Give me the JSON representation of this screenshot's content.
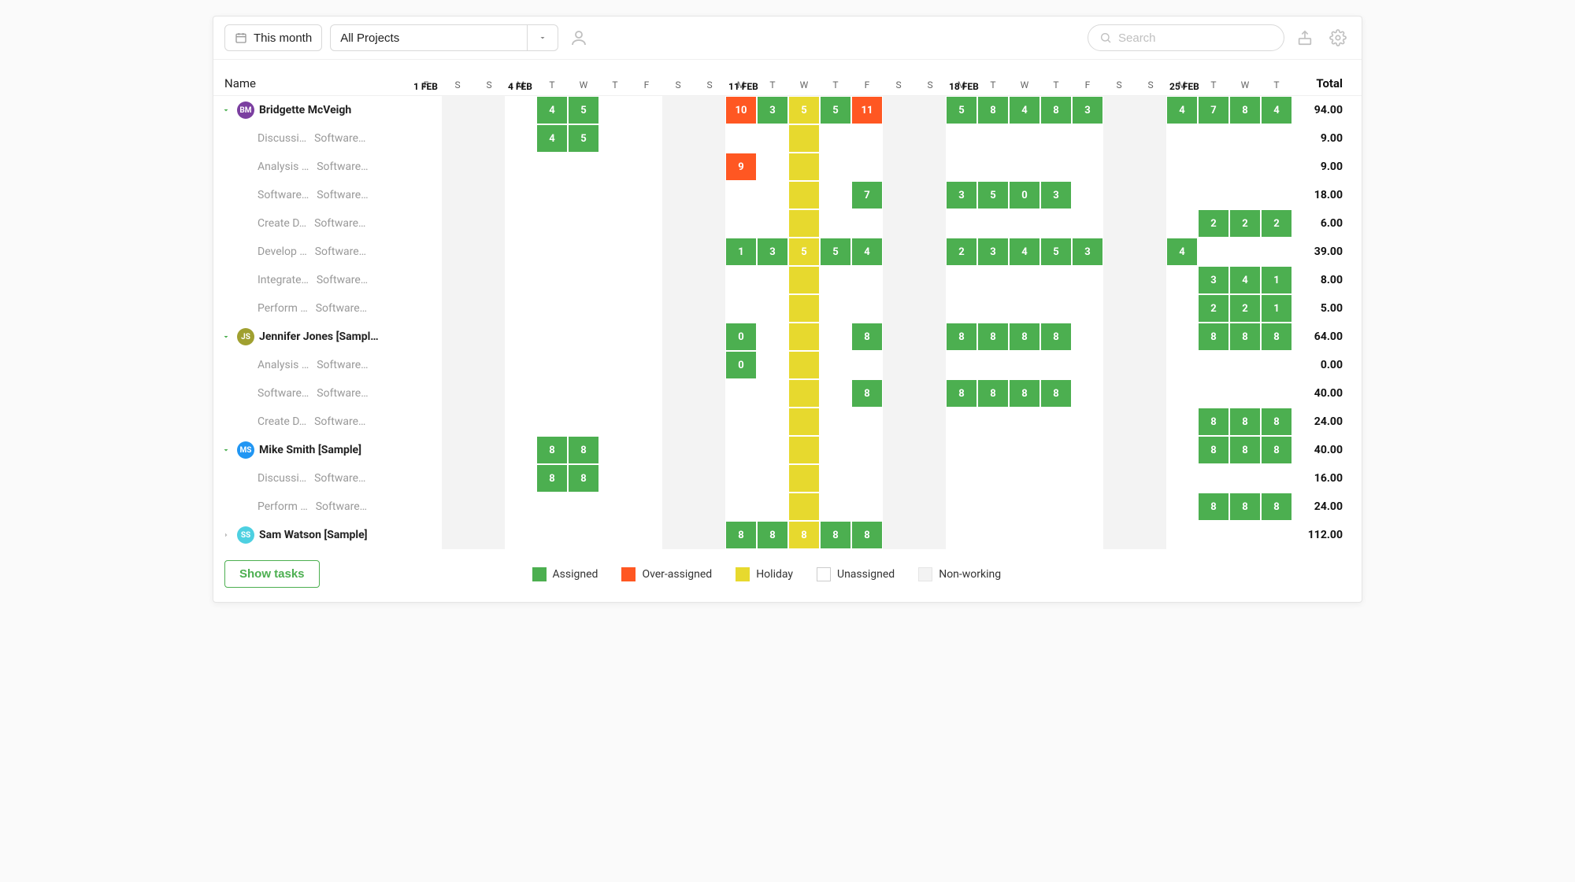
{
  "toolbar": {
    "range_label": "This month",
    "project_filter": "All Projects",
    "search_placeholder": "Search"
  },
  "header": {
    "name_label": "Name",
    "total_label": "Total",
    "days": [
      {
        "dow": "F",
        "weekstart": "1 FEB",
        "nonwork": false
      },
      {
        "dow": "S",
        "nonwork": true
      },
      {
        "dow": "S",
        "nonwork": true
      },
      {
        "dow": "M",
        "weekstart": "4 FEB",
        "nonwork": false
      },
      {
        "dow": "T",
        "nonwork": false
      },
      {
        "dow": "W",
        "nonwork": false
      },
      {
        "dow": "T",
        "nonwork": false
      },
      {
        "dow": "F",
        "nonwork": false
      },
      {
        "dow": "S",
        "nonwork": true
      },
      {
        "dow": "S",
        "nonwork": true
      },
      {
        "dow": "M",
        "weekstart": "11 FEB",
        "nonwork": false
      },
      {
        "dow": "T",
        "nonwork": false
      },
      {
        "dow": "W",
        "nonwork": false,
        "holiday": true
      },
      {
        "dow": "T",
        "nonwork": false
      },
      {
        "dow": "F",
        "nonwork": false
      },
      {
        "dow": "S",
        "nonwork": true
      },
      {
        "dow": "S",
        "nonwork": true
      },
      {
        "dow": "M",
        "weekstart": "18 FEB",
        "nonwork": false
      },
      {
        "dow": "T",
        "nonwork": false
      },
      {
        "dow": "W",
        "nonwork": false
      },
      {
        "dow": "T",
        "nonwork": false
      },
      {
        "dow": "F",
        "nonwork": false
      },
      {
        "dow": "S",
        "nonwork": true
      },
      {
        "dow": "S",
        "nonwork": true
      },
      {
        "dow": "M",
        "weekstart": "25 FEB",
        "nonwork": false
      },
      {
        "dow": "T",
        "nonwork": false
      },
      {
        "dow": "W",
        "nonwork": false
      },
      {
        "dow": "T",
        "nonwork": false
      }
    ]
  },
  "rows": [
    {
      "type": "person",
      "expanded": true,
      "avatar": {
        "initials": "BM",
        "bg": "#7b3fa0"
      },
      "name": "Bridgette McVeigh",
      "total": "94.00",
      "cells": [
        null,
        null,
        null,
        null,
        {
          "v": "4",
          "t": "assigned"
        },
        {
          "v": "5",
          "t": "assigned"
        },
        null,
        null,
        null,
        null,
        {
          "v": "10",
          "t": "over"
        },
        {
          "v": "3",
          "t": "assigned"
        },
        {
          "v": "5",
          "t": "holiday"
        },
        {
          "v": "5",
          "t": "assigned"
        },
        {
          "v": "11",
          "t": "over"
        },
        null,
        null,
        {
          "v": "5",
          "t": "assigned"
        },
        {
          "v": "8",
          "t": "assigned"
        },
        {
          "v": "4",
          "t": "assigned"
        },
        {
          "v": "8",
          "t": "assigned"
        },
        {
          "v": "3",
          "t": "assigned"
        },
        null,
        null,
        {
          "v": "4",
          "t": "assigned"
        },
        {
          "v": "7",
          "t": "assigned"
        },
        {
          "v": "8",
          "t": "assigned"
        },
        {
          "v": "4",
          "t": "assigned"
        }
      ]
    },
    {
      "type": "task",
      "task": "Discussi…",
      "project": "Software…",
      "total": "9.00",
      "cells": [
        null,
        null,
        null,
        null,
        {
          "v": "4",
          "t": "assigned"
        },
        {
          "v": "5",
          "t": "assigned"
        },
        null,
        null,
        null,
        null,
        null,
        null,
        {
          "t": "holiday-bg"
        },
        null,
        null,
        null,
        null,
        null,
        null,
        null,
        null,
        null,
        null,
        null,
        null,
        null,
        null,
        null
      ]
    },
    {
      "type": "task",
      "task": "Analysis …",
      "project": "Software…",
      "total": "9.00",
      "cells": [
        null,
        null,
        null,
        null,
        null,
        null,
        null,
        null,
        null,
        null,
        {
          "v": "9",
          "t": "over"
        },
        null,
        {
          "t": "holiday-bg"
        },
        null,
        null,
        null,
        null,
        null,
        null,
        null,
        null,
        null,
        null,
        null,
        null,
        null,
        null,
        null
      ]
    },
    {
      "type": "task",
      "task": "Software…",
      "project": "Software…",
      "total": "18.00",
      "cells": [
        null,
        null,
        null,
        null,
        null,
        null,
        null,
        null,
        null,
        null,
        null,
        null,
        {
          "t": "holiday-bg"
        },
        null,
        {
          "v": "7",
          "t": "assigned"
        },
        null,
        null,
        {
          "v": "3",
          "t": "assigned"
        },
        {
          "v": "5",
          "t": "assigned"
        },
        {
          "v": "0",
          "t": "assigned"
        },
        {
          "v": "3",
          "t": "assigned"
        },
        null,
        null,
        null,
        null,
        null,
        null,
        null
      ]
    },
    {
      "type": "task",
      "task": "Create D…",
      "project": "Software…",
      "total": "6.00",
      "cells": [
        null,
        null,
        null,
        null,
        null,
        null,
        null,
        null,
        null,
        null,
        null,
        null,
        {
          "t": "holiday-bg"
        },
        null,
        null,
        null,
        null,
        null,
        null,
        null,
        null,
        null,
        null,
        null,
        null,
        {
          "v": "2",
          "t": "assigned"
        },
        {
          "v": "2",
          "t": "assigned"
        },
        {
          "v": "2",
          "t": "assigned"
        }
      ]
    },
    {
      "type": "task",
      "task": "Develop …",
      "project": "Software…",
      "total": "39.00",
      "cells": [
        null,
        null,
        null,
        null,
        null,
        null,
        null,
        null,
        null,
        null,
        {
          "v": "1",
          "t": "assigned"
        },
        {
          "v": "3",
          "t": "assigned"
        },
        {
          "v": "5",
          "t": "holiday"
        },
        {
          "v": "5",
          "t": "assigned"
        },
        {
          "v": "4",
          "t": "assigned"
        },
        null,
        null,
        {
          "v": "2",
          "t": "assigned"
        },
        {
          "v": "3",
          "t": "assigned"
        },
        {
          "v": "4",
          "t": "assigned"
        },
        {
          "v": "5",
          "t": "assigned"
        },
        {
          "v": "3",
          "t": "assigned"
        },
        null,
        null,
        {
          "v": "4",
          "t": "assigned"
        },
        null,
        null,
        null
      ]
    },
    {
      "type": "task",
      "task": "Integrate…",
      "project": "Software…",
      "total": "8.00",
      "cells": [
        null,
        null,
        null,
        null,
        null,
        null,
        null,
        null,
        null,
        null,
        null,
        null,
        {
          "t": "holiday-bg"
        },
        null,
        null,
        null,
        null,
        null,
        null,
        null,
        null,
        null,
        null,
        null,
        null,
        {
          "v": "3",
          "t": "assigned"
        },
        {
          "v": "4",
          "t": "assigned"
        },
        {
          "v": "1",
          "t": "assigned"
        }
      ]
    },
    {
      "type": "task",
      "task": "Perform …",
      "project": "Software…",
      "total": "5.00",
      "cells": [
        null,
        null,
        null,
        null,
        null,
        null,
        null,
        null,
        null,
        null,
        null,
        null,
        {
          "t": "holiday-bg"
        },
        null,
        null,
        null,
        null,
        null,
        null,
        null,
        null,
        null,
        null,
        null,
        null,
        {
          "v": "2",
          "t": "assigned"
        },
        {
          "v": "2",
          "t": "assigned"
        },
        {
          "v": "1",
          "t": "assigned"
        }
      ]
    },
    {
      "type": "person",
      "expanded": true,
      "avatar": {
        "initials": "JS",
        "bg": "#a0a030"
      },
      "name": "Jennifer Jones [Sampl…",
      "total": "64.00",
      "cells": [
        null,
        null,
        null,
        null,
        null,
        null,
        null,
        null,
        null,
        null,
        {
          "v": "0",
          "t": "assigned"
        },
        null,
        {
          "t": "holiday-bg"
        },
        null,
        {
          "v": "8",
          "t": "assigned"
        },
        null,
        null,
        {
          "v": "8",
          "t": "assigned"
        },
        {
          "v": "8",
          "t": "assigned"
        },
        {
          "v": "8",
          "t": "assigned"
        },
        {
          "v": "8",
          "t": "assigned"
        },
        null,
        null,
        null,
        null,
        {
          "v": "8",
          "t": "assigned"
        },
        {
          "v": "8",
          "t": "assigned"
        },
        {
          "v": "8",
          "t": "assigned"
        }
      ]
    },
    {
      "type": "task",
      "task": "Analysis …",
      "project": "Software…",
      "total": "0.00",
      "cells": [
        null,
        null,
        null,
        null,
        null,
        null,
        null,
        null,
        null,
        null,
        {
          "v": "0",
          "t": "assigned"
        },
        null,
        {
          "t": "holiday-bg"
        },
        null,
        null,
        null,
        null,
        null,
        null,
        null,
        null,
        null,
        null,
        null,
        null,
        null,
        null,
        null
      ]
    },
    {
      "type": "task",
      "task": "Software…",
      "project": "Software…",
      "total": "40.00",
      "cells": [
        null,
        null,
        null,
        null,
        null,
        null,
        null,
        null,
        null,
        null,
        null,
        null,
        {
          "t": "holiday-bg"
        },
        null,
        {
          "v": "8",
          "t": "assigned"
        },
        null,
        null,
        {
          "v": "8",
          "t": "assigned"
        },
        {
          "v": "8",
          "t": "assigned"
        },
        {
          "v": "8",
          "t": "assigned"
        },
        {
          "v": "8",
          "t": "assigned"
        },
        null,
        null,
        null,
        null,
        null,
        null,
        null
      ]
    },
    {
      "type": "task",
      "task": "Create D…",
      "project": "Software…",
      "total": "24.00",
      "cells": [
        null,
        null,
        null,
        null,
        null,
        null,
        null,
        null,
        null,
        null,
        null,
        null,
        {
          "t": "holiday-bg"
        },
        null,
        null,
        null,
        null,
        null,
        null,
        null,
        null,
        null,
        null,
        null,
        null,
        {
          "v": "8",
          "t": "assigned"
        },
        {
          "v": "8",
          "t": "assigned"
        },
        {
          "v": "8",
          "t": "assigned"
        }
      ]
    },
    {
      "type": "person",
      "expanded": true,
      "avatar": {
        "initials": "MS",
        "bg": "#2196f3"
      },
      "name": "Mike Smith [Sample]",
      "total": "40.00",
      "cells": [
        null,
        null,
        null,
        null,
        {
          "v": "8",
          "t": "assigned"
        },
        {
          "v": "8",
          "t": "assigned"
        },
        null,
        null,
        null,
        null,
        null,
        null,
        {
          "t": "holiday-bg"
        },
        null,
        null,
        null,
        null,
        null,
        null,
        null,
        null,
        null,
        null,
        null,
        null,
        {
          "v": "8",
          "t": "assigned"
        },
        {
          "v": "8",
          "t": "assigned"
        },
        {
          "v": "8",
          "t": "assigned"
        }
      ]
    },
    {
      "type": "task",
      "task": "Discussi…",
      "project": "Software…",
      "total": "16.00",
      "cells": [
        null,
        null,
        null,
        null,
        {
          "v": "8",
          "t": "assigned"
        },
        {
          "v": "8",
          "t": "assigned"
        },
        null,
        null,
        null,
        null,
        null,
        null,
        {
          "t": "holiday-bg"
        },
        null,
        null,
        null,
        null,
        null,
        null,
        null,
        null,
        null,
        null,
        null,
        null,
        null,
        null,
        null
      ]
    },
    {
      "type": "task",
      "task": "Perform …",
      "project": "Software…",
      "total": "24.00",
      "cells": [
        null,
        null,
        null,
        null,
        null,
        null,
        null,
        null,
        null,
        null,
        null,
        null,
        {
          "t": "holiday-bg"
        },
        null,
        null,
        null,
        null,
        null,
        null,
        null,
        null,
        null,
        null,
        null,
        null,
        {
          "v": "8",
          "t": "assigned"
        },
        {
          "v": "8",
          "t": "assigned"
        },
        {
          "v": "8",
          "t": "assigned"
        }
      ]
    },
    {
      "type": "person",
      "expanded": false,
      "avatar": {
        "initials": "SS",
        "bg": "#4dd0e1"
      },
      "name": "Sam Watson [Sample]",
      "total": "112.00",
      "cells": [
        null,
        null,
        null,
        null,
        null,
        null,
        null,
        null,
        null,
        null,
        {
          "v": "8",
          "t": "assigned"
        },
        {
          "v": "8",
          "t": "assigned"
        },
        {
          "v": "8",
          "t": "holiday"
        },
        {
          "v": "8",
          "t": "assigned"
        },
        {
          "v": "8",
          "t": "assigned"
        },
        null,
        null,
        null,
        null,
        null,
        null,
        null,
        null,
        null,
        null,
        null,
        null,
        null
      ]
    }
  ],
  "footer": {
    "show_tasks": "Show tasks",
    "legend": {
      "assigned": "Assigned",
      "over": "Over-assigned",
      "holiday": "Holiday",
      "unassigned": "Unassigned",
      "nonwork": "Non-working"
    }
  }
}
